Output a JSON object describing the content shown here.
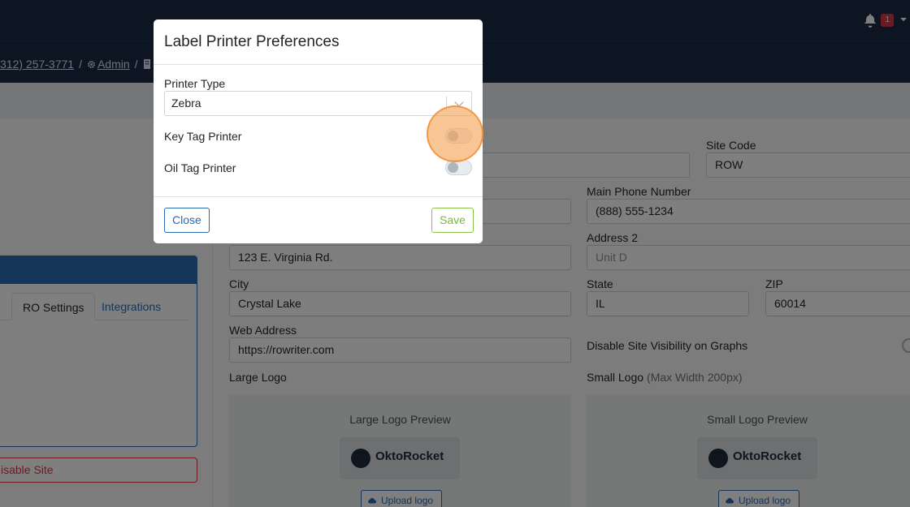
{
  "topbar": {
    "notification_count": "1",
    "icons": {
      "bell": "bell-icon",
      "caret": "caret-down-icon"
    }
  },
  "breadcrumb": {
    "phone": "312) 257-3771",
    "admin": "Admin",
    "sep": "/",
    "icons": {
      "admin": "gear-icon",
      "site": "building-icon"
    }
  },
  "left": {
    "tabs": [
      {
        "label": "RO Settings"
      },
      {
        "label": "Integrations"
      }
    ],
    "disable_site": "isable Site"
  },
  "form": {
    "site_code": {
      "label": "Site Code",
      "value": "ROW"
    },
    "main_phone": {
      "label": "Main Phone Number",
      "value": "(888) 555-1234"
    },
    "address1": {
      "value": "123 E. Virginia Rd."
    },
    "address2": {
      "label": "Address 2",
      "placeholder": "Unit D"
    },
    "city": {
      "label": "City",
      "value": "Crystal Lake"
    },
    "state": {
      "label": "State",
      "value": "IL"
    },
    "zip": {
      "label": "ZIP",
      "value": "60014"
    },
    "web": {
      "label": "Web Address",
      "value": "https://rowriter.com"
    },
    "graphs_toggle_label": "Disable Site Visibility on Graphs",
    "large_logo": {
      "label": "Large Logo",
      "preview": "Large Logo Preview",
      "brand": "OktoRocket",
      "upload": "Upload logo"
    },
    "small_logo": {
      "label": "Small Logo",
      "hint": "(Max Width 200px)",
      "preview": "Small Logo Preview",
      "brand": "OktoRocket",
      "upload": "Upload logo"
    }
  },
  "modal": {
    "title": "Label Printer Preferences",
    "printer_type_label": "Printer Type",
    "printer_type_value": "Zebra",
    "key_tag_label": "Key Tag Printer",
    "key_tag_on": false,
    "oil_tag_label": "Oil Tag Printer",
    "oil_tag_on": false,
    "close": "Close",
    "save": "Save"
  },
  "colors": {
    "navbar": "#1b2a47",
    "primary": "#2a6bb3",
    "danger": "#dc3545",
    "success": "#7cb342",
    "highlight": "#f5a65a"
  }
}
